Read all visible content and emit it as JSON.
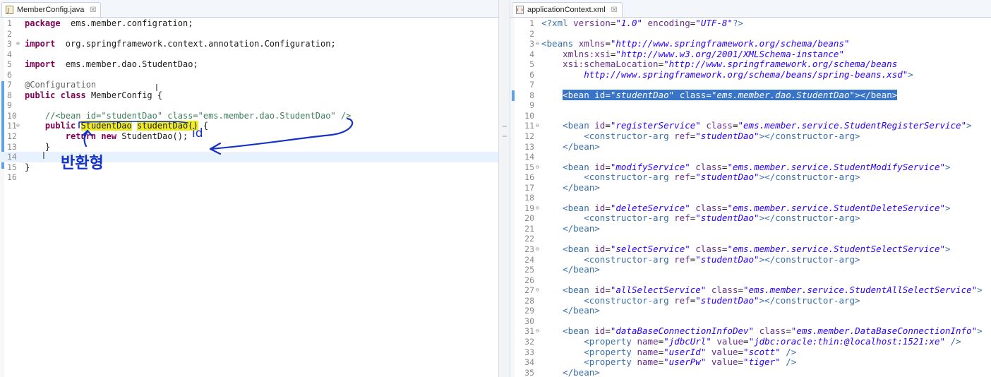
{
  "left_editor": {
    "tab_title": "MemberConfig.java",
    "tab_close": "☒",
    "lines": [
      {
        "n": "1",
        "segs": [
          [
            "kw",
            "package"
          ],
          [
            "",
            "  ems.member.configration;"
          ]
        ]
      },
      {
        "n": "2",
        "segs": []
      },
      {
        "n": "3",
        "fold": "⊕",
        "segs": [
          [
            "kw",
            "import"
          ],
          [
            "",
            "  org.springframework.context.annotation.Configuration;"
          ]
        ]
      },
      {
        "n": "4",
        "segs": []
      },
      {
        "n": "5",
        "segs": [
          [
            "kw",
            "import"
          ],
          [
            "",
            "  ems.member.dao.StudentDao;"
          ]
        ]
      },
      {
        "n": "6",
        "segs": []
      },
      {
        "n": "7",
        "segs": [
          [
            "ann",
            "@Configuration"
          ]
        ]
      },
      {
        "n": "8",
        "segs": [
          [
            "kw",
            "public"
          ],
          [
            "",
            " "
          ],
          [
            "kw",
            "class"
          ],
          [
            "",
            " MemberConfig {"
          ]
        ]
      },
      {
        "n": "9",
        "segs": []
      },
      {
        "n": "10",
        "segs": [
          [
            "cmt",
            "    //<bean id=\"studentDao\" class=\"ems.member.dao.StudentDao\" />"
          ]
        ]
      },
      {
        "n": "11",
        "fold": "⊖",
        "segs": [
          [
            "",
            "    "
          ],
          [
            "kw",
            "public"
          ],
          [
            "",
            " "
          ],
          [
            "mark",
            "StudentDao"
          ],
          [
            "",
            " "
          ],
          [
            "mark",
            "studentDao()"
          ],
          [
            "",
            " {"
          ]
        ]
      },
      {
        "n": "12",
        "segs": [
          [
            "",
            "        "
          ],
          [
            "kw",
            "return"
          ],
          [
            "",
            " "
          ],
          [
            "kw",
            "new"
          ],
          [
            "",
            " StudentDao();"
          ]
        ]
      },
      {
        "n": "13",
        "segs": [
          [
            "",
            "    }"
          ]
        ]
      },
      {
        "n": "14",
        "cur": true,
        "segs": []
      },
      {
        "n": "15",
        "segs": [
          [
            "",
            "}"
          ]
        ]
      },
      {
        "n": "16",
        "segs": []
      }
    ]
  },
  "right_editor": {
    "tab_title": "applicationContext.xml",
    "tab_close": "☒",
    "lines": [
      {
        "n": "1",
        "segs": [
          [
            "tag",
            "<?xml "
          ],
          [
            "attr",
            "version"
          ],
          [
            "",
            "="
          ],
          [
            "val",
            "\"1.0\""
          ],
          [
            "",
            " "
          ],
          [
            "attr",
            "encoding"
          ],
          [
            "",
            "="
          ],
          [
            "val",
            "\"UTF-8\""
          ],
          [
            "tag",
            "?>"
          ]
        ]
      },
      {
        "n": "2",
        "segs": []
      },
      {
        "n": "3",
        "fold": "⊖",
        "segs": [
          [
            "tag",
            "<beans "
          ],
          [
            "attr",
            "xmlns"
          ],
          [
            "",
            "="
          ],
          [
            "val",
            "\"http://www.springframework.org/schema/beans\""
          ]
        ]
      },
      {
        "n": "4",
        "segs": [
          [
            "",
            "    "
          ],
          [
            "attr",
            "xmlns:xsi"
          ],
          [
            "",
            "="
          ],
          [
            "val",
            "\"http://www.w3.org/2001/XMLSchema-instance\""
          ]
        ]
      },
      {
        "n": "5",
        "segs": [
          [
            "",
            "    "
          ],
          [
            "attr",
            "xsi:schemaLocation"
          ],
          [
            "",
            "="
          ],
          [
            "val",
            "\"http://www.springframework.org/schema/beans"
          ]
        ]
      },
      {
        "n": "6",
        "segs": [
          [
            "",
            "        "
          ],
          [
            "val",
            "http://www.springframework.org/schema/beans/spring-beans.xsd\""
          ],
          [
            "tag",
            ">"
          ]
        ]
      },
      {
        "n": "7",
        "segs": []
      },
      {
        "n": "8",
        "sel": true,
        "segs": [
          [
            "",
            "    "
          ],
          [
            "tag",
            "<bean "
          ],
          [
            "attr",
            "id"
          ],
          [
            "",
            "="
          ],
          [
            "val",
            "\"studentDao\""
          ],
          [
            "",
            " "
          ],
          [
            "attr",
            "class"
          ],
          [
            "",
            "="
          ],
          [
            "val",
            "\"ems.member.dao.StudentDao\""
          ],
          [
            "tag",
            "></bean>"
          ]
        ]
      },
      {
        "n": "9",
        "segs": []
      },
      {
        "n": "10",
        "segs": []
      },
      {
        "n": "11",
        "fold": "⊖",
        "segs": [
          [
            "",
            "    "
          ],
          [
            "tag",
            "<bean "
          ],
          [
            "attr",
            "id"
          ],
          [
            "",
            "="
          ],
          [
            "val",
            "\"registerService\""
          ],
          [
            "",
            " "
          ],
          [
            "attr",
            "class"
          ],
          [
            "",
            "="
          ],
          [
            "val",
            "\"ems.member.service.StudentRegisterService\""
          ],
          [
            "tag",
            ">"
          ]
        ]
      },
      {
        "n": "12",
        "segs": [
          [
            "",
            "        "
          ],
          [
            "tag",
            "<constructor-arg "
          ],
          [
            "attr",
            "ref"
          ],
          [
            "",
            "="
          ],
          [
            "val",
            "\"studentDao\""
          ],
          [
            "tag",
            "></constructor-arg>"
          ]
        ]
      },
      {
        "n": "13",
        "segs": [
          [
            "",
            "    "
          ],
          [
            "tag",
            "</bean>"
          ]
        ]
      },
      {
        "n": "14",
        "segs": []
      },
      {
        "n": "15",
        "fold": "⊖",
        "segs": [
          [
            "",
            "    "
          ],
          [
            "tag",
            "<bean "
          ],
          [
            "attr",
            "id"
          ],
          [
            "",
            "="
          ],
          [
            "val",
            "\"modifyService\""
          ],
          [
            "",
            " "
          ],
          [
            "attr",
            "class"
          ],
          [
            "",
            "="
          ],
          [
            "val",
            "\"ems.member.service.StudentModifyService\""
          ],
          [
            "tag",
            ">"
          ]
        ]
      },
      {
        "n": "16",
        "segs": [
          [
            "",
            "        "
          ],
          [
            "tag",
            "<constructor-arg "
          ],
          [
            "attr",
            "ref"
          ],
          [
            "",
            "="
          ],
          [
            "val",
            "\"studentDao\""
          ],
          [
            "tag",
            "></constructor-arg>"
          ]
        ]
      },
      {
        "n": "17",
        "segs": [
          [
            "",
            "    "
          ],
          [
            "tag",
            "</bean>"
          ]
        ]
      },
      {
        "n": "18",
        "segs": []
      },
      {
        "n": "19",
        "fold": "⊖",
        "segs": [
          [
            "",
            "    "
          ],
          [
            "tag",
            "<bean "
          ],
          [
            "attr",
            "id"
          ],
          [
            "",
            "="
          ],
          [
            "val",
            "\"deleteService\""
          ],
          [
            "",
            " "
          ],
          [
            "attr",
            "class"
          ],
          [
            "",
            "="
          ],
          [
            "val",
            "\"ems.member.service.StudentDeleteService\""
          ],
          [
            "tag",
            ">"
          ]
        ]
      },
      {
        "n": "20",
        "segs": [
          [
            "",
            "        "
          ],
          [
            "tag",
            "<constructor-arg "
          ],
          [
            "attr",
            "ref"
          ],
          [
            "",
            "="
          ],
          [
            "val",
            "\"studentDao\""
          ],
          [
            "tag",
            "></constructor-arg>"
          ]
        ]
      },
      {
        "n": "21",
        "segs": [
          [
            "",
            "    "
          ],
          [
            "tag",
            "</bean>"
          ]
        ]
      },
      {
        "n": "22",
        "segs": []
      },
      {
        "n": "23",
        "fold": "⊖",
        "segs": [
          [
            "",
            "    "
          ],
          [
            "tag",
            "<bean "
          ],
          [
            "attr",
            "id"
          ],
          [
            "",
            "="
          ],
          [
            "val",
            "\"selectService\""
          ],
          [
            "",
            " "
          ],
          [
            "attr",
            "class"
          ],
          [
            "",
            "="
          ],
          [
            "val",
            "\"ems.member.service.StudentSelectService\""
          ],
          [
            "tag",
            ">"
          ]
        ]
      },
      {
        "n": "24",
        "segs": [
          [
            "",
            "        "
          ],
          [
            "tag",
            "<constructor-arg "
          ],
          [
            "attr",
            "ref"
          ],
          [
            "",
            "="
          ],
          [
            "val",
            "\"studentDao\""
          ],
          [
            "tag",
            "></constructor-arg>"
          ]
        ]
      },
      {
        "n": "25",
        "segs": [
          [
            "",
            "    "
          ],
          [
            "tag",
            "</bean>"
          ]
        ]
      },
      {
        "n": "26",
        "segs": []
      },
      {
        "n": "27",
        "fold": "⊖",
        "segs": [
          [
            "",
            "    "
          ],
          [
            "tag",
            "<bean "
          ],
          [
            "attr",
            "id"
          ],
          [
            "",
            "="
          ],
          [
            "val",
            "\"allSelectService\""
          ],
          [
            "",
            " "
          ],
          [
            "attr",
            "class"
          ],
          [
            "",
            "="
          ],
          [
            "val",
            "\"ems.member.service.StudentAllSelectService\""
          ],
          [
            "tag",
            ">"
          ]
        ]
      },
      {
        "n": "28",
        "segs": [
          [
            "",
            "        "
          ],
          [
            "tag",
            "<constructor-arg "
          ],
          [
            "attr",
            "ref"
          ],
          [
            "",
            "="
          ],
          [
            "val",
            "\"studentDao\""
          ],
          [
            "tag",
            "></constructor-arg>"
          ]
        ]
      },
      {
        "n": "29",
        "segs": [
          [
            "",
            "    "
          ],
          [
            "tag",
            "</bean>"
          ]
        ]
      },
      {
        "n": "30",
        "segs": []
      },
      {
        "n": "31",
        "fold": "⊖",
        "segs": [
          [
            "",
            "    "
          ],
          [
            "tag",
            "<bean "
          ],
          [
            "attr",
            "id"
          ],
          [
            "",
            "="
          ],
          [
            "val",
            "\"dataBaseConnectionInfoDev\""
          ],
          [
            "",
            " "
          ],
          [
            "attr",
            "class"
          ],
          [
            "",
            "="
          ],
          [
            "val",
            "\"ems.member.DataBaseConnectionInfo\""
          ],
          [
            "tag",
            ">"
          ]
        ]
      },
      {
        "n": "32",
        "segs": [
          [
            "",
            "        "
          ],
          [
            "tag",
            "<property "
          ],
          [
            "attr",
            "name"
          ],
          [
            "",
            "="
          ],
          [
            "val",
            "\"jdbcUrl\""
          ],
          [
            "",
            " "
          ],
          [
            "attr",
            "value"
          ],
          [
            "",
            "="
          ],
          [
            "val",
            "\"jdbc:oracle:thin:@localhost:1521:xe\""
          ],
          [
            "",
            " "
          ],
          [
            "tag",
            "/>"
          ]
        ]
      },
      {
        "n": "33",
        "segs": [
          [
            "",
            "        "
          ],
          [
            "tag",
            "<property "
          ],
          [
            "attr",
            "name"
          ],
          [
            "",
            "="
          ],
          [
            "val",
            "\"userId\""
          ],
          [
            "",
            " "
          ],
          [
            "attr",
            "value"
          ],
          [
            "",
            "="
          ],
          [
            "val",
            "\"scott\""
          ],
          [
            "",
            " "
          ],
          [
            "tag",
            "/>"
          ]
        ]
      },
      {
        "n": "34",
        "segs": [
          [
            "",
            "        "
          ],
          [
            "tag",
            "<property "
          ],
          [
            "attr",
            "name"
          ],
          [
            "",
            "="
          ],
          [
            "val",
            "\"userPw\""
          ],
          [
            "",
            " "
          ],
          [
            "attr",
            "value"
          ],
          [
            "",
            "="
          ],
          [
            "val",
            "\"tiger\""
          ],
          [
            "",
            " "
          ],
          [
            "tag",
            "/>"
          ]
        ]
      },
      {
        "n": "35",
        "segs": [
          [
            "",
            "    "
          ],
          [
            "tag",
            "</bean>"
          ]
        ]
      }
    ]
  },
  "annotations": {
    "handwritten_id": "id",
    "handwritten_return_type": "반환형",
    "ink_color": "#1432c8"
  },
  "colors": {
    "keyword": "#7f0055",
    "comment": "#3f7f5f",
    "xml_value": "#2a00ff",
    "selection": "#3874c8",
    "highlight": "#f0ec22"
  }
}
